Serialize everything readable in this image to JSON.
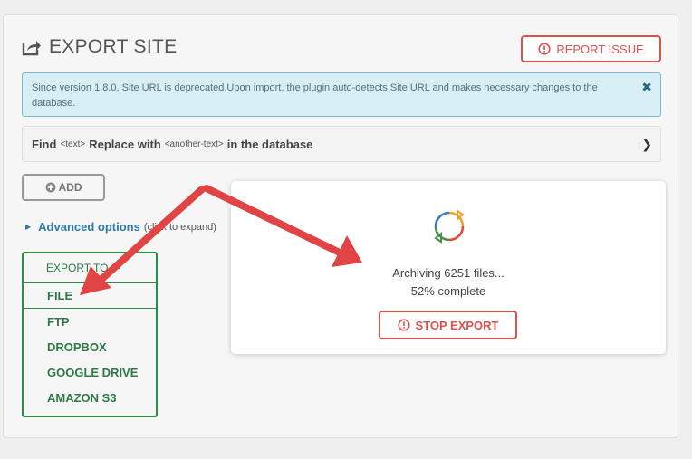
{
  "header": {
    "title": "EXPORT SITE",
    "title_icon": "share-icon",
    "report_label": "REPORT ISSUE",
    "report_icon": "alert-circle-icon"
  },
  "notice": {
    "text": "Since version 1.8.0, Site URL is deprecated.Upon import, the plugin auto-detects Site URL and makes necessary changes to the database.",
    "close": "✖"
  },
  "find_replace": {
    "find": "Find",
    "find_ph": "<text>",
    "replace": "Replace with",
    "replace_ph": "<another-text>",
    "suffix": "in the database",
    "chevron": "❯"
  },
  "add": {
    "icon": "plus-circle-icon",
    "label": "ADD"
  },
  "advanced": {
    "label": "Advanced options",
    "hint": "(click to expand)"
  },
  "export_menu": {
    "heading": "EXPORT TO",
    "items": [
      "FILE",
      "FTP",
      "DROPBOX",
      "GOOGLE DRIVE",
      "AMAZON S3"
    ]
  },
  "progress": {
    "line1": "Archiving 6251 files...",
    "line2": "52% complete",
    "percent": 52,
    "stop_label": "STOP EXPORT",
    "spinner_icon": "sync-icon"
  },
  "colors": {
    "accent_red": "#d9534f",
    "accent_green": "#2c8a4a",
    "notice_bg": "#d8eef5",
    "link_blue": "#2e7aa5"
  }
}
